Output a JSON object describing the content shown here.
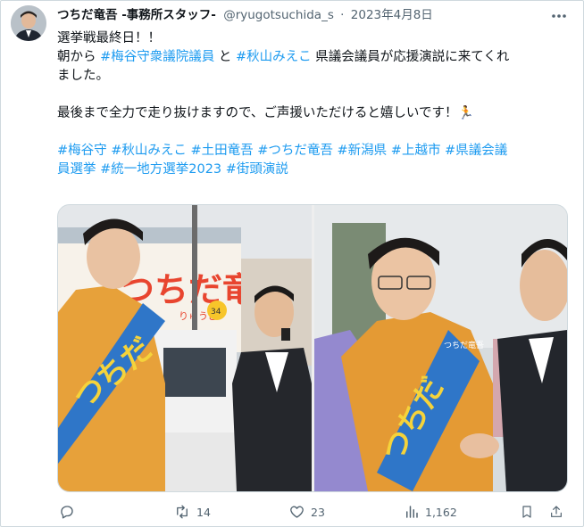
{
  "tweet": {
    "author_name": "つちだ竜吾 -事務所スタッフ-",
    "handle": "@ryugotsuchida_s",
    "separator": "·",
    "date": "2023年4月8日",
    "line1": "選挙戦最終日！！",
    "line2_prefix": "朝から ",
    "line2_link1": "#梅谷守衆議院議員",
    "line2_mid": " と ",
    "line2_link2": "#秋山みえこ",
    "line2_suffix": " 県議会議員が応援演説に来てくれ",
    "line3": "ました。",
    "line5": "最後まで全力で走り抜けますので、ご声援いただけると嬉しいです！🏃",
    "hashtags_line1": " #梅谷守 #秋山みえこ #土田竜吾  #つちだ竜吾 #新潟県 #上越市 #県議会議",
    "hashtags_line2": "員選挙  #統一地方選挙2023  #街頭演説"
  },
  "photos": {
    "left_sash_text": "つちだ",
    "left_sign_text": "つちだ竜吾",
    "left_sign_sub": "りゅうご",
    "right_sash_text": "つちだ",
    "right_sash_label": "つちだ竜吾"
  },
  "actions": {
    "reply_count": "",
    "retweet_count": "14",
    "like_count": "23",
    "view_count": "1,162"
  },
  "colors": {
    "link": "#1d9bf0",
    "muted": "#536471",
    "text": "#0f1419"
  }
}
